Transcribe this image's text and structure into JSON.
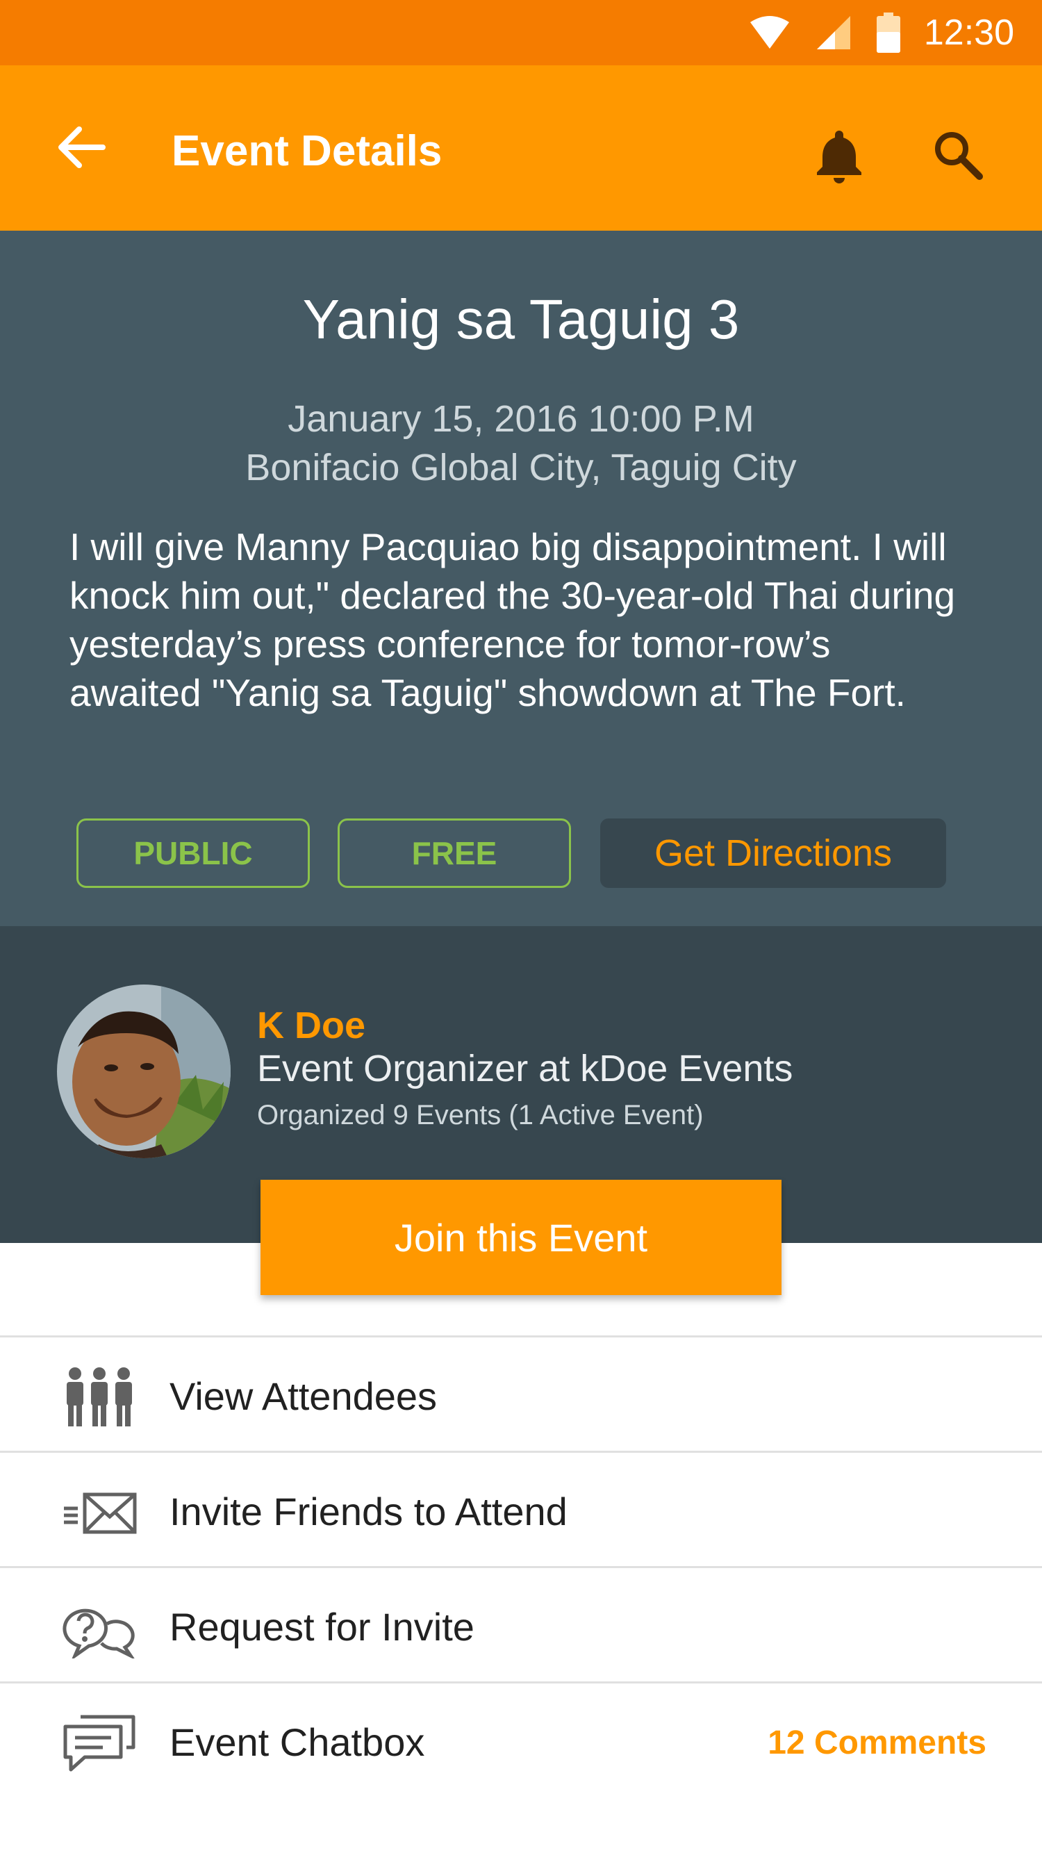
{
  "status_bar": {
    "time": "12:30",
    "icons": [
      "wifi-icon",
      "signal-icon",
      "battery-icon"
    ]
  },
  "app_bar": {
    "title": "Event Details",
    "icons": [
      "back-arrow-icon",
      "bell-icon",
      "search-icon"
    ]
  },
  "event": {
    "name": "Yanig sa Taguig 3",
    "date": "January 15, 2016 10:00 P.M",
    "venue": "Bonifacio Global City, Taguig City",
    "description": "I will give Manny Pacquiao big disappointment. I will knock him out,\" declared the 30-year-old Thai during yesterday’s press conference for tomor-row’s awaited \"Yanig sa Taguig\" showdown at The Fort.",
    "tags": [
      "PUBLIC",
      "FREE"
    ],
    "directions_label": "Get Directions"
  },
  "organizer": {
    "name": "K Doe",
    "role": "Event Organizer at kDoe Events",
    "stats": "Organized 9 Events (1 Active Event)"
  },
  "join_label": "Join this Event",
  "menu": [
    {
      "icon": "attendees-icon",
      "label": "View Attendees"
    },
    {
      "icon": "invite-mail-icon",
      "label": "Invite Friends to Attend"
    },
    {
      "icon": "question-chat-icon",
      "label": "Request for Invite"
    },
    {
      "icon": "chat-icon",
      "label": "Event Chatbox",
      "count": "12 Comments"
    }
  ],
  "colors": {
    "primary": "#FF9800",
    "status_bar": "#F57C00",
    "hero": "#455A64",
    "organizer": "#37474F",
    "tag": "#8BC34A"
  }
}
